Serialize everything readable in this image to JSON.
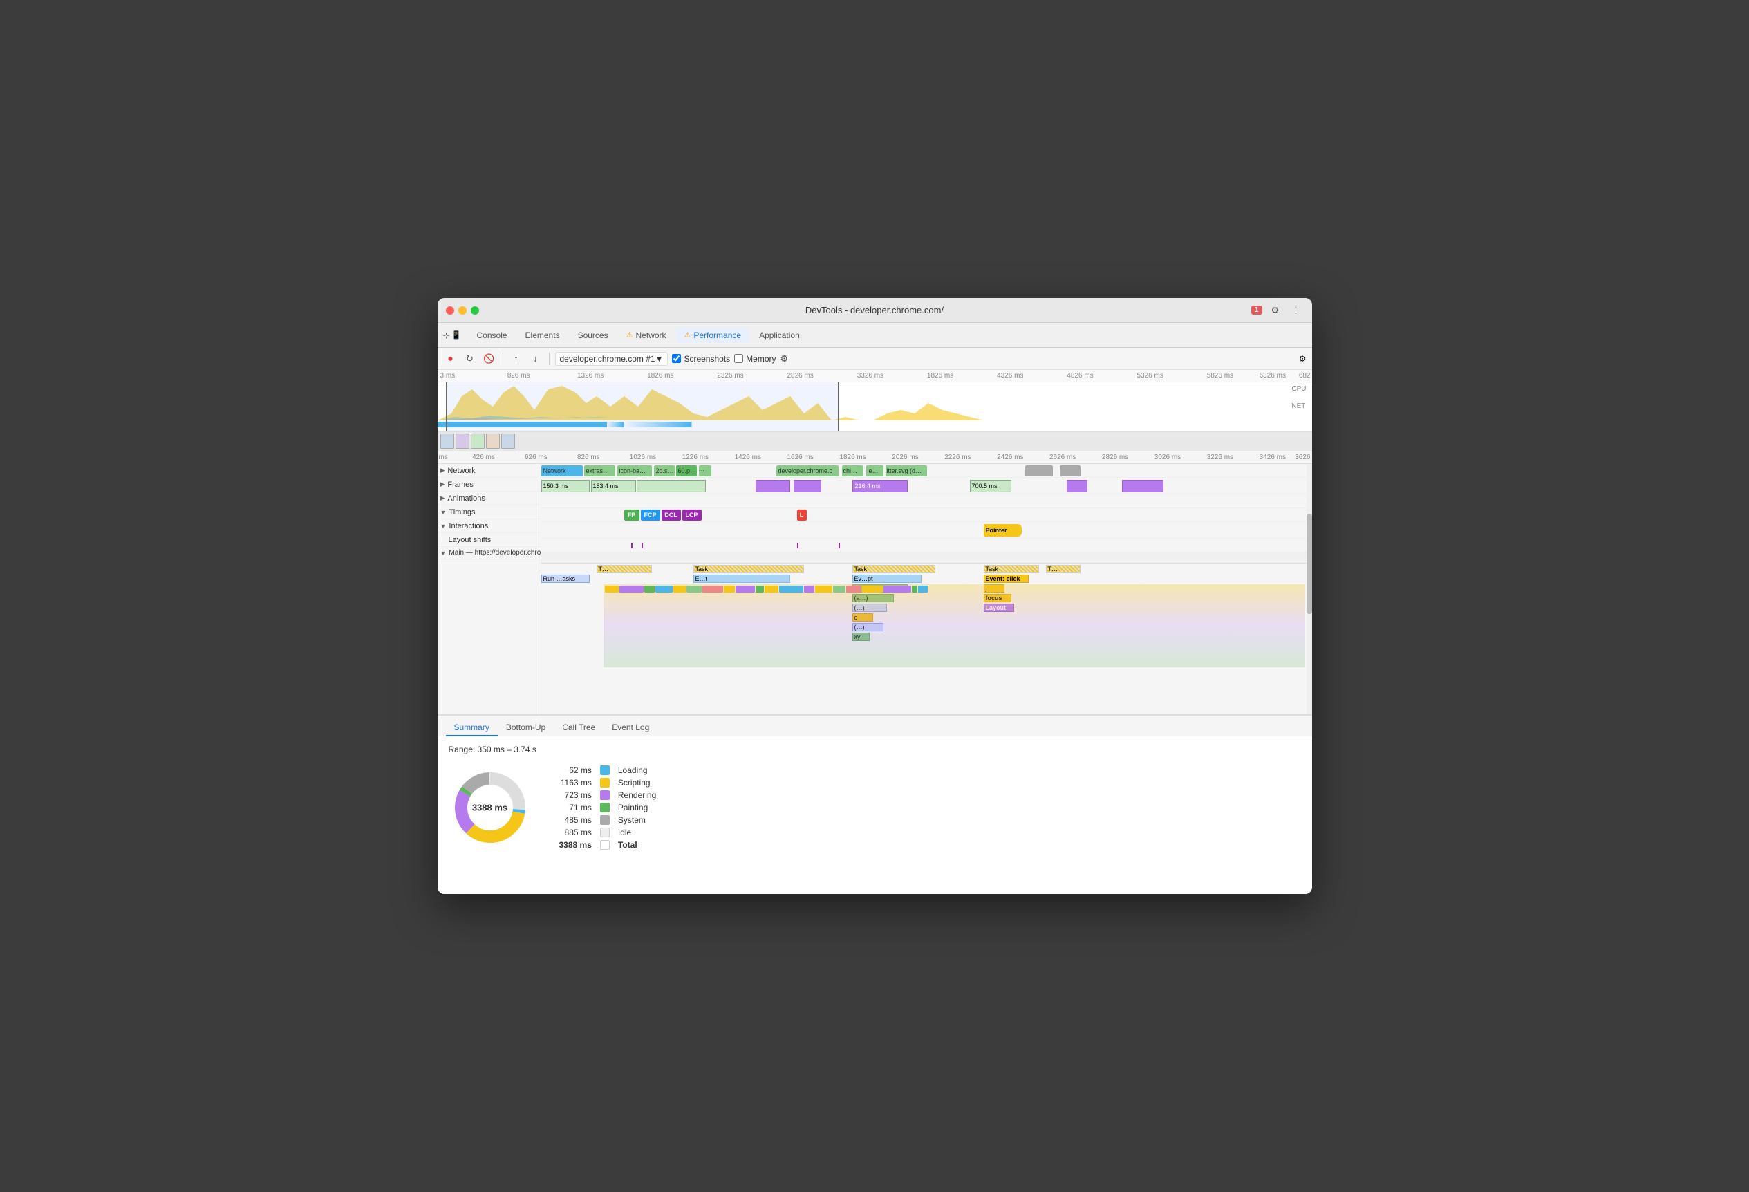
{
  "window": {
    "title": "DevTools - developer.chrome.com/"
  },
  "tabs": [
    {
      "label": "Console",
      "active": false,
      "icon": null
    },
    {
      "label": "Elements",
      "active": false,
      "icon": null
    },
    {
      "label": "Sources",
      "active": false,
      "icon": null
    },
    {
      "label": "Network",
      "active": false,
      "icon": "warn"
    },
    {
      "label": "Performance",
      "active": true,
      "icon": "warn"
    },
    {
      "label": "Application",
      "active": false,
      "icon": null
    }
  ],
  "toolbar": {
    "url": "developer.chrome.com #1▼",
    "screenshots_label": "Screenshots",
    "memory_label": "Memory"
  },
  "sidebar_rows": [
    {
      "label": "Network",
      "indent": 0,
      "arrow": "▶"
    },
    {
      "label": "Frames",
      "indent": 0,
      "arrow": "▶"
    },
    {
      "label": "Animations",
      "indent": 0,
      "arrow": "▶"
    },
    {
      "label": "Timings",
      "indent": 0,
      "arrow": "▼"
    },
    {
      "label": "Interactions",
      "indent": 0,
      "arrow": "▼"
    },
    {
      "label": "Layout shifts",
      "indent": 1,
      "arrow": null
    },
    {
      "label": "Main — https://developer.chrome.com/",
      "indent": 0,
      "arrow": "▼"
    }
  ],
  "bottom_tabs": [
    "Summary",
    "Bottom-Up",
    "Call Tree",
    "Event Log"
  ],
  "active_bottom_tab": "Summary",
  "range_text": "Range: 350 ms – 3.74 s",
  "donut_label": "3388 ms",
  "legend": [
    {
      "value": "62 ms",
      "color": "#4db6e8",
      "label": "Loading"
    },
    {
      "value": "1163 ms",
      "color": "#f5c518",
      "label": "Scripting"
    },
    {
      "value": "723 ms",
      "color": "#b57bee",
      "label": "Rendering"
    },
    {
      "value": "71 ms",
      "color": "#5cb85c",
      "label": "Painting"
    },
    {
      "value": "485 ms",
      "color": "#aaa",
      "label": "System"
    },
    {
      "value": "885 ms",
      "color": "#eee",
      "label": "Idle",
      "border": true
    },
    {
      "value": "3388 ms",
      "color": "white",
      "label": "Total",
      "border": true,
      "bold": true
    }
  ],
  "ruler_ticks": [
    "3 ms",
    "826 ms",
    "1326 ms",
    "1826 ms",
    "2326 ms",
    "2826 ms",
    "3326 ms",
    "1826 ms",
    "4326 ms",
    "4826 ms",
    "5326 ms",
    "5826 ms",
    "6326 ms",
    "682"
  ],
  "second_ruler_ticks": [
    "ms",
    "426 ms",
    "626 ms",
    "826 ms",
    "1026 ms",
    "1226 ms",
    "1426 ms",
    "1626 ms",
    "1826 ms",
    "2026 ms",
    "2226 ms",
    "2426 ms",
    "2626 ms",
    "2826 ms",
    "3026 ms",
    "3226 ms",
    "3426 ms",
    "3626"
  ],
  "timing_markers": [
    {
      "label": "FP",
      "color": "#4caf50"
    },
    {
      "label": "FCP",
      "color": "#2196f3"
    },
    {
      "label": "DCL",
      "color": "#9c27b0"
    },
    {
      "label": "LCP",
      "color": "#9c27b0"
    },
    {
      "label": "L",
      "color": "#f44336"
    }
  ],
  "colors": {
    "accent_blue": "#1a73e8",
    "warn_orange": "#f59e0b",
    "loading": "#4db6e8",
    "scripting": "#f5c518",
    "rendering": "#b57bee",
    "painting": "#5cb85c",
    "system": "#aaaaaa",
    "idle": "#eeeeee"
  }
}
